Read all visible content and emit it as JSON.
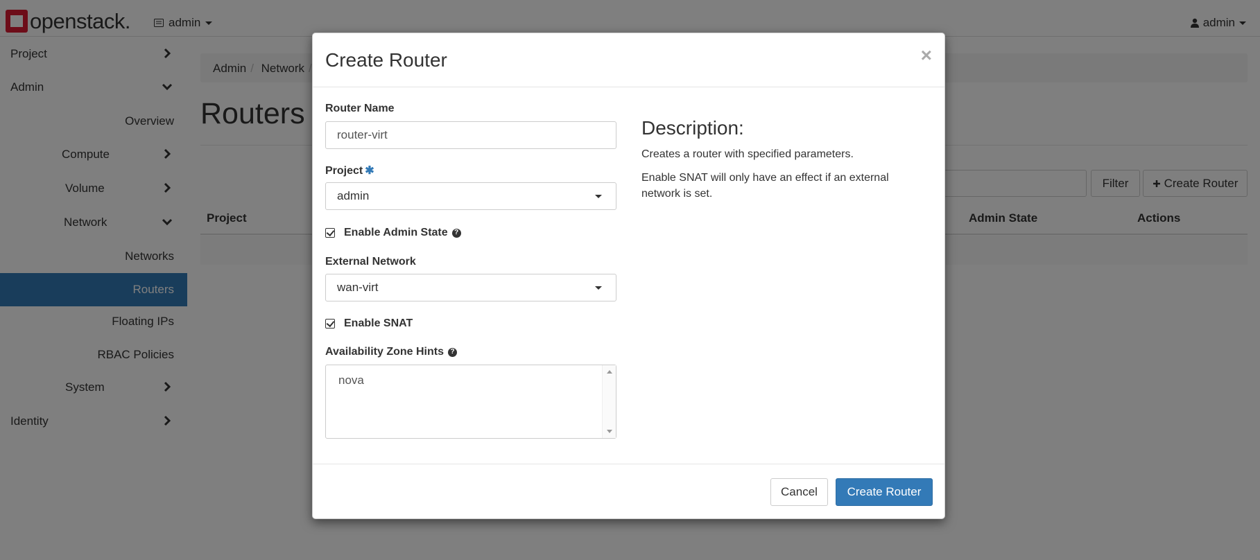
{
  "topbar": {
    "brand": "openstack.",
    "project_selector": "admin",
    "user_menu": "admin"
  },
  "sidebar": {
    "items": [
      {
        "label": "Project"
      },
      {
        "label": "Admin"
      },
      {
        "label": "Overview"
      },
      {
        "label": "Compute"
      },
      {
        "label": "Volume"
      },
      {
        "label": "Network"
      },
      {
        "label": "Networks"
      },
      {
        "label": "Routers"
      },
      {
        "label": "Floating IPs"
      },
      {
        "label": "RBAC Policies"
      },
      {
        "label": "System"
      },
      {
        "label": "Identity"
      }
    ]
  },
  "breadcrumb": {
    "items": [
      "Admin",
      "Network"
    ]
  },
  "page": {
    "title": "Routers",
    "filter_button": "Filter",
    "create_button": "Create Router",
    "table_headers": [
      "Project",
      "Admin State",
      "Actions"
    ]
  },
  "modal": {
    "title": "Create Router",
    "close": "×",
    "fields": {
      "router_name": {
        "label": "Router Name",
        "value": "router-virt"
      },
      "project": {
        "label": "Project",
        "required_mark": "✱",
        "value": "admin"
      },
      "enable_admin_state": {
        "label": "Enable Admin State",
        "checked": true
      },
      "external_network": {
        "label": "External Network",
        "value": "wan-virt"
      },
      "enable_snat": {
        "label": "Enable SNAT",
        "checked": true
      },
      "availability_zone_hints": {
        "label": "Availability Zone Hints",
        "options": [
          "nova"
        ]
      }
    },
    "description": {
      "title": "Description:",
      "p1": "Creates a router with specified parameters.",
      "p2": "Enable SNAT will only have an effect if an external network is set."
    },
    "buttons": {
      "cancel": "Cancel",
      "submit": "Create Router"
    }
  },
  "colors": {
    "brand_red": "#da1a32",
    "primary": "#337ab7"
  }
}
